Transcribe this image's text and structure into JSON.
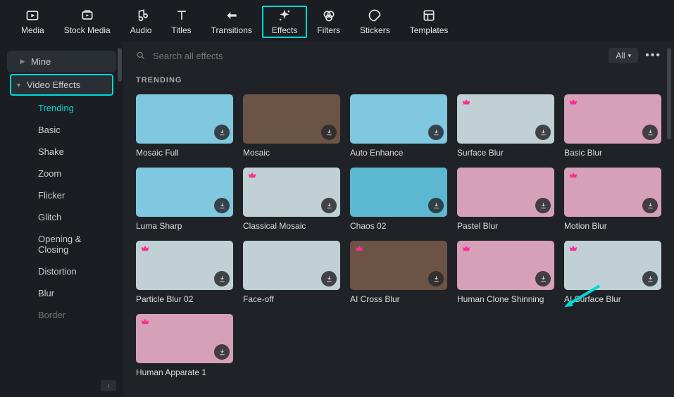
{
  "top_tabs": [
    {
      "id": "media",
      "label": "Media"
    },
    {
      "id": "stock-media",
      "label": "Stock Media"
    },
    {
      "id": "audio",
      "label": "Audio"
    },
    {
      "id": "titles",
      "label": "Titles"
    },
    {
      "id": "transitions",
      "label": "Transitions"
    },
    {
      "id": "effects",
      "label": "Effects",
      "active": true
    },
    {
      "id": "filters",
      "label": "Filters"
    },
    {
      "id": "stickers",
      "label": "Stickers"
    },
    {
      "id": "templates",
      "label": "Templates"
    }
  ],
  "sidebar": {
    "mine": "Mine",
    "video_effects": "Video Effects",
    "subs": [
      "Trending",
      "Basic",
      "Shake",
      "Zoom",
      "Flicker",
      "Glitch",
      "Opening & Closing",
      "Distortion",
      "Blur",
      "Border"
    ]
  },
  "search": {
    "placeholder": "Search all effects"
  },
  "filter": {
    "label": "All"
  },
  "section_title": "TRENDING",
  "effects": [
    {
      "name": "Mosaic Full",
      "cls": "t-blue"
    },
    {
      "name": "Mosaic",
      "cls": "t-brown"
    },
    {
      "name": "Auto Enhance",
      "cls": "t-blue"
    },
    {
      "name": "Surface Blur",
      "cls": "t-soft",
      "premium": true
    },
    {
      "name": "Basic Blur",
      "cls": "t-pink",
      "premium": true
    },
    {
      "name": "Luma Sharp",
      "cls": "t-blue"
    },
    {
      "name": "Classical Mosaic",
      "cls": "t-soft",
      "premium": true
    },
    {
      "name": "Chaos 02",
      "cls": "t-cyan"
    },
    {
      "name": "Pastel Blur",
      "cls": "t-pink"
    },
    {
      "name": "Motion Blur",
      "cls": "t-pink",
      "premium": true
    },
    {
      "name": "Particle Blur 02",
      "cls": "t-soft",
      "premium": true
    },
    {
      "name": "Face-off",
      "cls": "t-soft"
    },
    {
      "name": "AI Cross Blur",
      "cls": "t-brown",
      "premium": true
    },
    {
      "name": "Human Clone Shinning",
      "cls": "t-pink",
      "premium": true
    },
    {
      "name": "AI Surface Blur",
      "cls": "t-soft",
      "premium": true
    },
    {
      "name": "Human Apparate 1",
      "cls": "t-pink",
      "premium": true
    }
  ]
}
